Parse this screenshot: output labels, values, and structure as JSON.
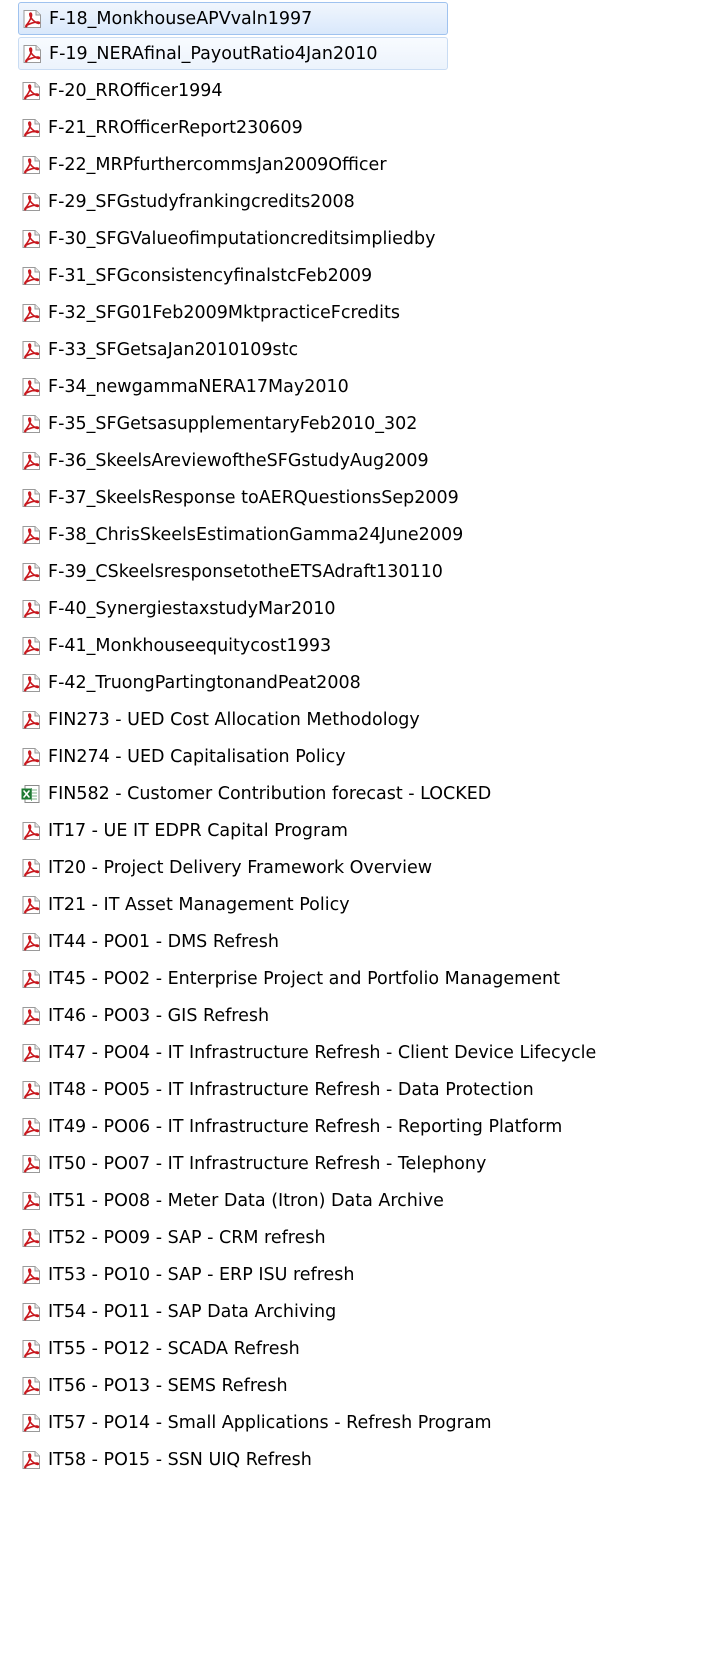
{
  "colors": {
    "pdf_icon": "#c8181e",
    "excel_icon": "#1d7a32",
    "selection_fill": "#dbe9fb",
    "selection_border": "#9fc2ef",
    "text": "#000000"
  },
  "files": [
    {
      "name": "F-18_MonkhouseAPVvaln1997",
      "icon": "pdf-icon",
      "selected": "primary"
    },
    {
      "name": "F-19_NERAfinal_PayoutRatio4Jan2010",
      "icon": "pdf-icon",
      "selected": "soft"
    },
    {
      "name": "F-20_RROfficer1994",
      "icon": "pdf-icon"
    },
    {
      "name": "F-21_RROfficerReport230609",
      "icon": "pdf-icon"
    },
    {
      "name": "F-22_MRPfurthercommsJan2009Officer",
      "icon": "pdf-icon"
    },
    {
      "name": "F-29_SFGstudyfrankingcredits2008",
      "icon": "pdf-icon"
    },
    {
      "name": "F-30_SFGValueofimputationcreditsimpliedby",
      "icon": "pdf-icon"
    },
    {
      "name": "F-31_SFGconsistencyfinalstcFeb2009",
      "icon": "pdf-icon"
    },
    {
      "name": "F-32_SFG01Feb2009MktpracticeFcredits",
      "icon": "pdf-icon"
    },
    {
      "name": "F-33_SFGetsaJan2010109stc",
      "icon": "pdf-icon"
    },
    {
      "name": "F-34_newgammaNERA17May2010",
      "icon": "pdf-icon"
    },
    {
      "name": "F-35_SFGetsasupplementaryFeb2010_302",
      "icon": "pdf-icon"
    },
    {
      "name": "F-36_SkeelsAreviewoftheSFGstudyAug2009",
      "icon": "pdf-icon"
    },
    {
      "name": "F-37_SkeelsResponse toAERQuestionsSep2009",
      "icon": "pdf-icon"
    },
    {
      "name": "F-38_ChrisSkeelsEstimationGamma24June2009",
      "icon": "pdf-icon"
    },
    {
      "name": "F-39_CSkeelsresponsetotheETSAdraft130110",
      "icon": "pdf-icon"
    },
    {
      "name": "F-40_SynergiestaxstudyMar2010",
      "icon": "pdf-icon"
    },
    {
      "name": "F-41_Monkhouseequitycost1993",
      "icon": "pdf-icon"
    },
    {
      "name": "F-42_TruongPartingtonandPeat2008",
      "icon": "pdf-icon"
    },
    {
      "name": "FIN273 - UED Cost Allocation Methodology",
      "icon": "pdf-icon"
    },
    {
      "name": "FIN274 - UED Capitalisation Policy",
      "icon": "pdf-icon"
    },
    {
      "name": "FIN582 - Customer Contribution forecast - LOCKED",
      "icon": "excel-icon"
    },
    {
      "name": "IT17 - UE IT EDPR Capital Program",
      "icon": "pdf-icon"
    },
    {
      "name": "IT20 - Project Delivery Framework Overview",
      "icon": "pdf-icon"
    },
    {
      "name": "IT21 - IT Asset Management Policy",
      "icon": "pdf-icon"
    },
    {
      "name": "IT44 - PO01 - DMS Refresh",
      "icon": "pdf-icon"
    },
    {
      "name": "IT45 - PO02 - Enterprise Project and Portfolio Management",
      "icon": "pdf-icon"
    },
    {
      "name": "IT46 - PO03 - GIS Refresh",
      "icon": "pdf-icon"
    },
    {
      "name": "IT47 - PO04 - IT Infrastructure Refresh - Client Device Lifecycle",
      "icon": "pdf-icon"
    },
    {
      "name": "IT48 - PO05 - IT Infrastructure Refresh - Data Protection",
      "icon": "pdf-icon"
    },
    {
      "name": "IT49 - PO06 - IT Infrastructure Refresh - Reporting Platform",
      "icon": "pdf-icon"
    },
    {
      "name": "IT50 - PO07 - IT Infrastructure Refresh - Telephony",
      "icon": "pdf-icon"
    },
    {
      "name": "IT51 - PO08 - Meter Data (Itron) Data Archive",
      "icon": "pdf-icon"
    },
    {
      "name": "IT52 - PO09 - SAP - CRM refresh",
      "icon": "pdf-icon"
    },
    {
      "name": "IT53 - PO10 - SAP - ERP ISU refresh",
      "icon": "pdf-icon"
    },
    {
      "name": "IT54 - PO11 - SAP Data Archiving",
      "icon": "pdf-icon"
    },
    {
      "name": "IT55 - PO12 - SCADA Refresh",
      "icon": "pdf-icon"
    },
    {
      "name": "IT56 - PO13 - SEMS Refresh",
      "icon": "pdf-icon"
    },
    {
      "name": "IT57 - PO14 - Small Applications - Refresh Program",
      "icon": "pdf-icon"
    },
    {
      "name": "IT58 - PO15 - SSN UIQ Refresh",
      "icon": "pdf-icon"
    }
  ]
}
